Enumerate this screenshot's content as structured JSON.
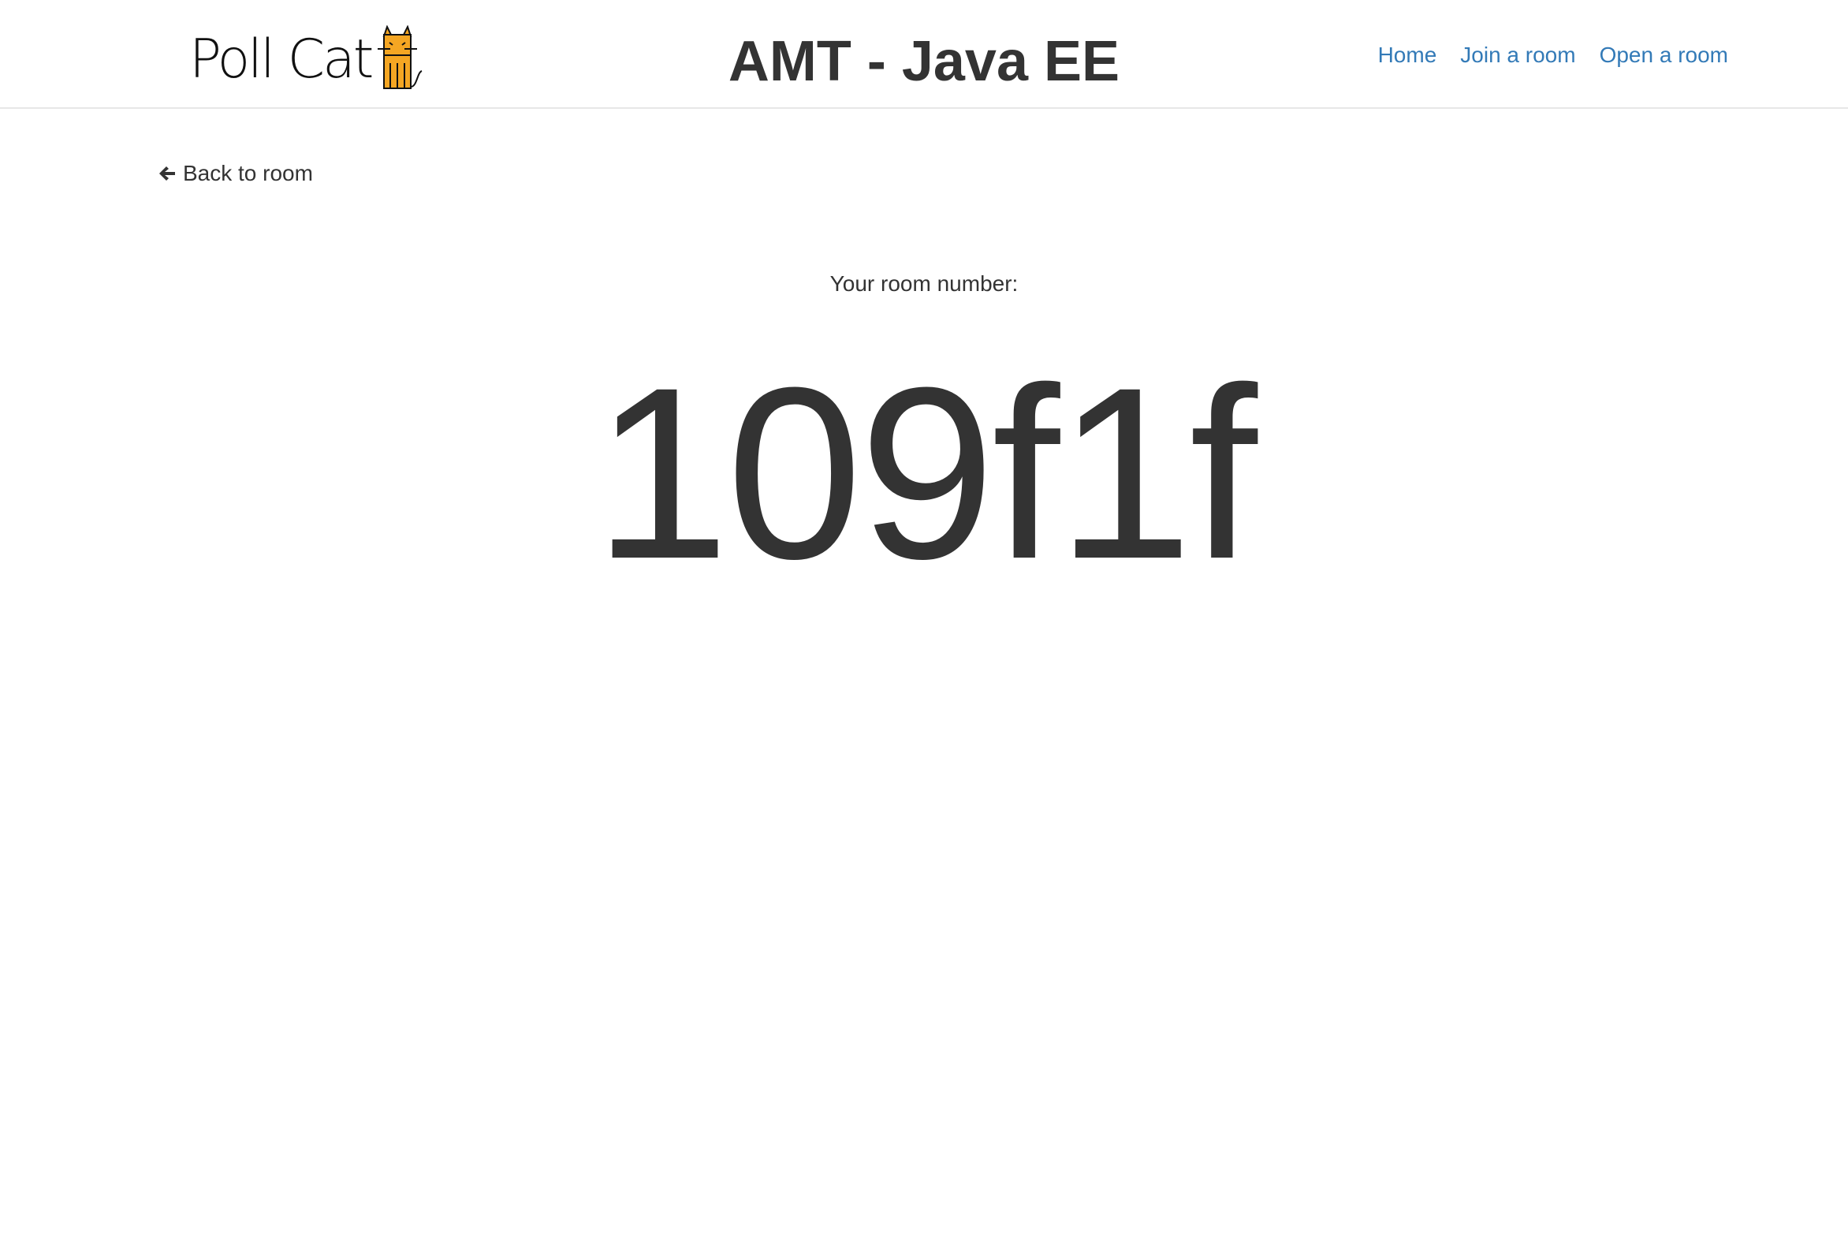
{
  "navbar": {
    "brand_text": "Poll Cat",
    "brand_icon": "cat-icon",
    "title": "AMT - Java EE",
    "links": [
      {
        "label": "Home"
      },
      {
        "label": "Join a room"
      },
      {
        "label": "Open a room"
      }
    ],
    "link_color": "#337ab7"
  },
  "main": {
    "back_link_label": "Back to room",
    "back_icon": "arrow-left-icon",
    "room_label": "Your room number:",
    "room_number": "109f1f"
  }
}
